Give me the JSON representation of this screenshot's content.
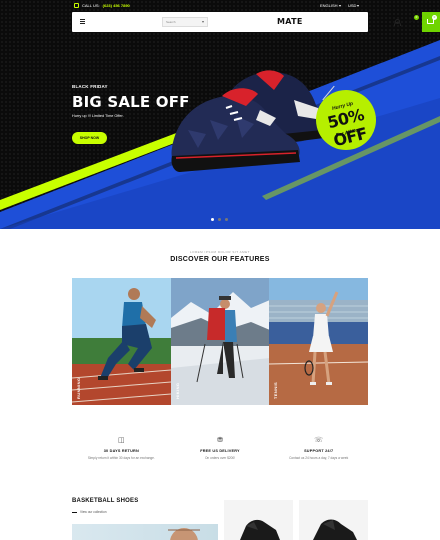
{
  "topbar": {
    "call_label": "CALL US:",
    "phone": "(623) 456 7890",
    "language": "ENGLISH",
    "currency": "USD"
  },
  "header": {
    "search_placeholder": "Search",
    "logo": "MATE",
    "wishlist_count": "0",
    "cart_count": "0"
  },
  "hero": {
    "kicker": "BLACK FRIDAY",
    "headline": "BIG SALE OFF",
    "subtext": "Hurry up !!! Limited Time Offer.",
    "button": "SHOP NOW",
    "promo_line1": "Hurry Up",
    "promo_line2": "50% OFF",
    "promo_line3": "For All Item",
    "slides": 3,
    "active_slide": 1,
    "colors": {
      "accent": "#c8ff00",
      "stripe_blue": "#1e4fd8",
      "cart_green": "#6fd400"
    }
  },
  "features": {
    "eyebrow": "LOREM IPSUM DOLOR SIT AMET",
    "title": "DISCOVER OUR FEATURES",
    "tiles": [
      {
        "label": "RUNNING"
      },
      {
        "label": "HIKING"
      },
      {
        "label": "TENNIS"
      }
    ]
  },
  "services": [
    {
      "icon": "gift-icon",
      "title": "30 DAYS RETURN",
      "desc": "Simply return it within 30 days for an exchange."
    },
    {
      "icon": "truck-icon",
      "title": "FREE US DELIVERY",
      "desc": "On orders over $200!"
    },
    {
      "icon": "support-icon",
      "title": "SUPPORT 24/7",
      "desc": "Contact us 24 hours a day, 7 days a week"
    }
  ],
  "basketball": {
    "title": "BASKETBALL SHOES",
    "link": "View our collection"
  }
}
